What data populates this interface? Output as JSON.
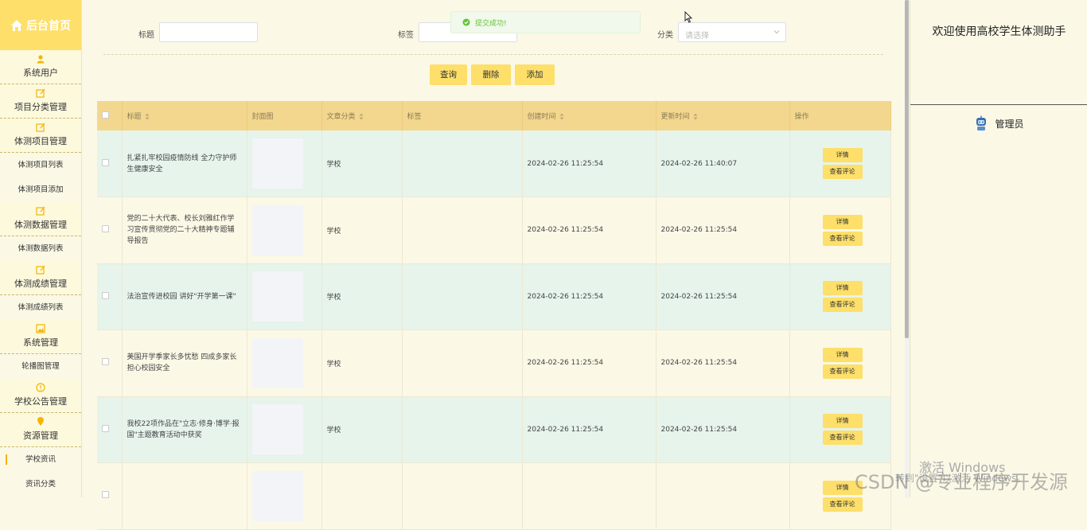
{
  "sidebar": {
    "brand": "后台首页",
    "groups": [
      {
        "label": "系统用户",
        "icon": "user-icon",
        "subs": []
      },
      {
        "label": "项目分类管理",
        "icon": "edit-icon",
        "subs": []
      },
      {
        "label": "体测项目管理",
        "icon": "edit-icon",
        "subs": [
          "体测项目列表",
          "体测项目添加"
        ]
      },
      {
        "label": "体测数据管理",
        "icon": "edit-icon",
        "subs": [
          "体测数据列表"
        ]
      },
      {
        "label": "体测成绩管理",
        "icon": "edit-icon",
        "subs": [
          "体测成绩列表"
        ]
      },
      {
        "label": "系统管理",
        "icon": "image-icon",
        "subs": [
          "轮播图管理"
        ]
      },
      {
        "label": "学校公告管理",
        "icon": "info-icon",
        "subs": []
      },
      {
        "label": "资源管理",
        "icon": "pin-icon",
        "subs": [
          "学校资讯",
          "资讯分类"
        ]
      }
    ],
    "active_sub": "学校资讯"
  },
  "search": {
    "title_label": "标题",
    "tag_label": "标签",
    "category_label": "分类",
    "category_placeholder": "请选择"
  },
  "toast": {
    "message": "提交成功!"
  },
  "buttons": {
    "query": "查询",
    "delete": "删除",
    "add": "添加"
  },
  "table": {
    "headers": [
      "标题",
      "封面图",
      "文章分类",
      "标签",
      "创建时间",
      "更新时间",
      "操作"
    ],
    "detail_label": "详情",
    "comment_label": "查看评论",
    "rows": [
      {
        "title": "扎紧扎牢校园疫情防线 全力守护师生健康安全",
        "category": "学校",
        "tag": "",
        "created": "2024-02-26 11:25:54",
        "updated": "2024-02-26 11:40:07"
      },
      {
        "title": "党的二十大代表、校长刘雅红作学习宣传贯彻党的二十大精神专题辅导报告",
        "category": "学校",
        "tag": "",
        "created": "2024-02-26 11:25:54",
        "updated": "2024-02-26 11:25:54"
      },
      {
        "title": "法治宣传进校园 讲好\"开学第一课\"",
        "category": "学校",
        "tag": "",
        "created": "2024-02-26 11:25:54",
        "updated": "2024-02-26 11:25:54"
      },
      {
        "title": "美国开学季家长多忧愁 四成多家长担心校园安全",
        "category": "学校",
        "tag": "",
        "created": "2024-02-26 11:25:54",
        "updated": "2024-02-26 11:25:54"
      },
      {
        "title": "我校22项作品在\"立志·修身·博学·报国\"主题教育活动中获奖",
        "category": "学校",
        "tag": "",
        "created": "2024-02-26 11:25:54",
        "updated": "2024-02-26 11:25:54"
      },
      {
        "title": "",
        "category": "",
        "tag": "",
        "created": "",
        "updated": ""
      }
    ]
  },
  "right_panel": {
    "welcome": "欢迎使用高校学生体测助手",
    "admin": "管理员"
  },
  "overlay": {
    "windows_activate": "激活 Windows",
    "windows_hint": "转到\"设置\"以激活 Windows。",
    "csdn": "CSDN @专业程序开发源"
  },
  "colors": {
    "accent": "#fddf6a",
    "header_bg": "#f3d78e",
    "row_alt": "#e6f4ec",
    "toast_green": "#67c23a"
  }
}
